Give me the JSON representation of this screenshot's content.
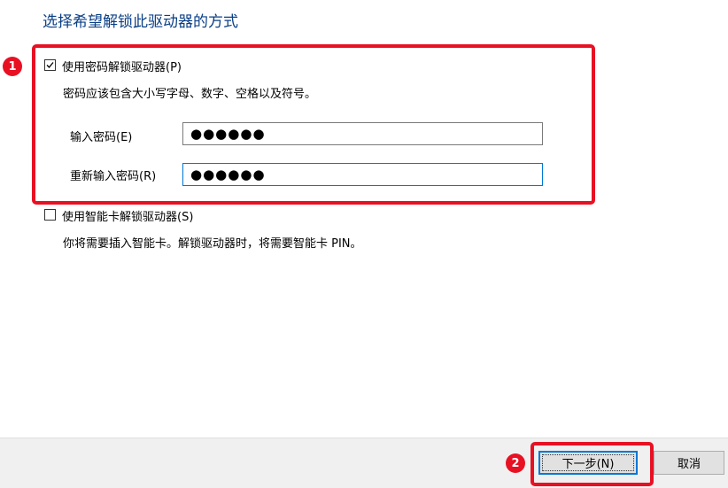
{
  "title": "选择希望解锁此驱动器的方式",
  "password_option": {
    "checkbox_label": "使用密码解锁驱动器(P)",
    "checked": true,
    "hint": "密码应该包含大小写字母、数字、空格以及符号。",
    "password_label": "输入密码(E)",
    "password_value": "●●●●●●",
    "reenter_label": "重新输入密码(R)",
    "reenter_value": "●●●●●●"
  },
  "smartcard_option": {
    "checkbox_label": "使用智能卡解锁驱动器(S)",
    "checked": false,
    "hint": "你将需要插入智能卡。解锁驱动器时，将需要智能卡 PIN。"
  },
  "annotations": {
    "step1": "1",
    "step2": "2",
    "highlight_color": "#e81123"
  },
  "footer": {
    "next_label": "下一步(N)",
    "cancel_label": "取消"
  },
  "colors": {
    "title": "#0a3f86",
    "focus_border": "#0078d7",
    "footer_bg": "#f0f0f0"
  }
}
